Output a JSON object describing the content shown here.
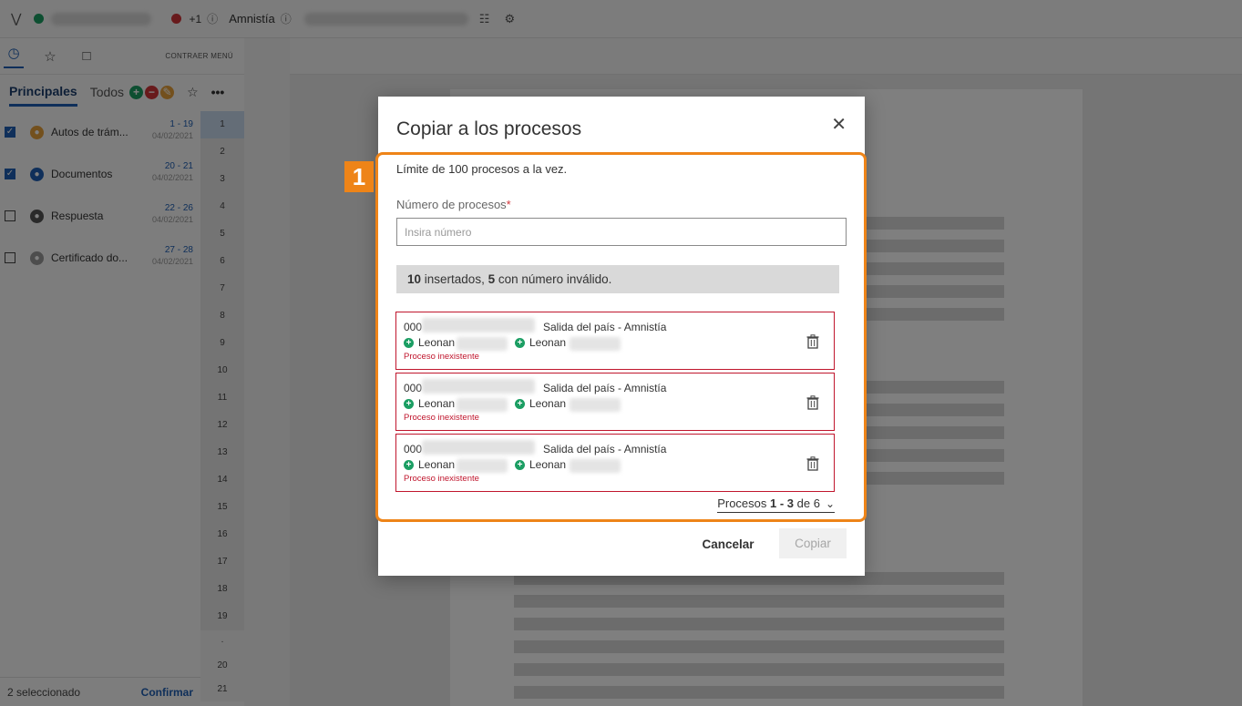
{
  "topbar": {
    "badge_count": "+1",
    "context_label": "Amnistía"
  },
  "sidebar": {
    "collapse_label": "CONTRAER MENÚ",
    "tab_main": "Principales",
    "tab_all": "Todos",
    "documents": [
      {
        "name": "Autos de trám...",
        "pages": "1 - 19",
        "date": "04/02/2021",
        "checked": true,
        "icon_color": "#e7a13a"
      },
      {
        "name": "Documentos",
        "pages": "20 - 21",
        "date": "04/02/2021",
        "checked": true,
        "icon_color": "#1e5fb4"
      },
      {
        "name": "Respuesta",
        "pages": "22 - 26",
        "date": "04/02/2021",
        "checked": false,
        "icon_color": "#555555"
      },
      {
        "name": "Certificado do...",
        "pages": "27 - 28",
        "date": "04/02/2021",
        "checked": false,
        "icon_color": "#9a9a9a"
      }
    ],
    "page_numbers": [
      "1",
      "2",
      "3",
      "4",
      "5",
      "6",
      "7",
      "8",
      "9",
      "10",
      "11",
      "12",
      "13",
      "14",
      "15",
      "16",
      "17",
      "18",
      "19"
    ],
    "extra_pages": [
      "·",
      "20",
      "21"
    ],
    "footer": {
      "selected": "2 seleccionado",
      "confirm": "Confirmar"
    }
  },
  "modal": {
    "title": "Copiar a los procesos",
    "step": "1",
    "limit_text": "Límite de 100 procesos a la vez.",
    "field_label": "Número de procesos",
    "required_mark": "*",
    "input_placeholder": "Insira número",
    "input_value": "",
    "summary": {
      "inserted": "10",
      "inserted_text": " insertados, ",
      "invalid": "5",
      "invalid_text": " con número inválido."
    },
    "processes": [
      {
        "number_prefix": "000",
        "type": "Salida del país - Amnistía",
        "party1": "Leonan",
        "party2": "Leonan",
        "error": "Proceso inexistente"
      },
      {
        "number_prefix": "000",
        "type": "Salida del país - Amnistía",
        "party1": "Leonan",
        "party2": "Leonan",
        "error": "Proceso inexistente"
      },
      {
        "number_prefix": "000",
        "type": "Salida del país - Amnistía",
        "party1": "Leonan",
        "party2": "Leonan",
        "error": "Proceso inexistente"
      }
    ],
    "pager": {
      "prefix": "Procesos ",
      "range": "1 - 3",
      "of": " de 6"
    },
    "cancel_label": "Cancelar",
    "copy_label": "Copiar"
  },
  "colors": {
    "accent": "#1e5fb4",
    "highlight": "#ee8418",
    "error": "#c0162d",
    "success": "#1b9e63"
  }
}
